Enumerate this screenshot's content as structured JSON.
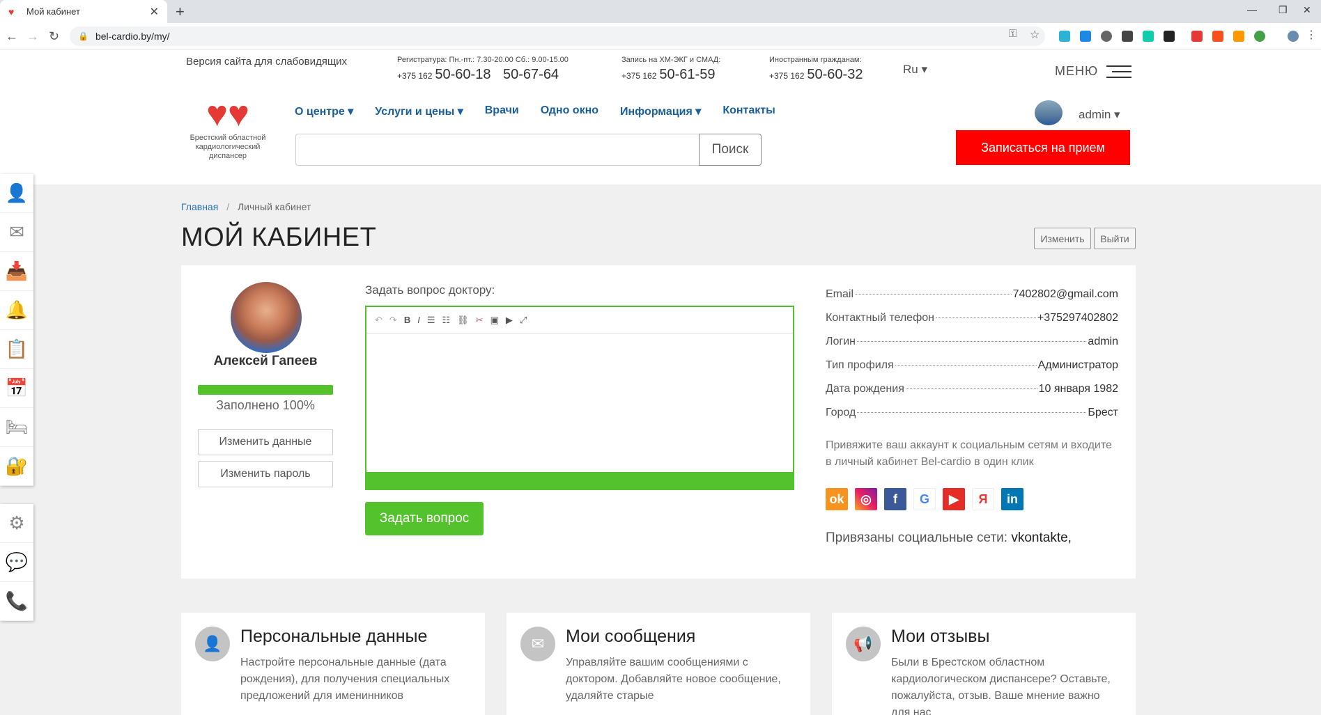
{
  "browser": {
    "tab_title": "Мой кабинет",
    "url": "bel-cardio.by/my/"
  },
  "header": {
    "low_vision": "Версия сайта для слабовидящих",
    "reg_label": "Регистратура: Пн.-пт.: 7.30-20.00 Сб.: 9.00-15.00",
    "reg_code": "+375 162",
    "reg_phone1": "50-60-18",
    "reg_phone2": "50-67-64",
    "ecg_label": "Запись на ХМ-ЭКГ и СМАД:",
    "ecg_code": "+375 162",
    "ecg_phone": "50-61-59",
    "foreign_label": "Иностранным гражданам:",
    "foreign_code": "+375 162",
    "foreign_phone": "50-60-32",
    "lang": "Ru",
    "menu_label": "МЕНЮ",
    "logo_text": "Брестский областной кардиологический диспансер",
    "nav": [
      "О центре",
      "Услуги и цены",
      "Врачи",
      "Одно окно",
      "Информация",
      "Контакты"
    ],
    "search_button": "Поиск",
    "user_name": "admin",
    "book_button": "Записаться на прием"
  },
  "breadcrumb": {
    "home": "Главная",
    "current": "Личный кабинет"
  },
  "page_title": "МОЙ КАБИНЕТ",
  "actions": {
    "edit": "Изменить",
    "logout": "Выйти"
  },
  "profile": {
    "name": "Алексей Гапеев",
    "progress_percent": 100,
    "progress_label": "Заполнено 100%",
    "change_data": "Изменить данные",
    "change_password": "Изменить пароль"
  },
  "question": {
    "label": "Задать вопрос доктору:",
    "submit": "Задать вопрос"
  },
  "info": [
    {
      "label": "Email",
      "value": "7402802@gmail.com"
    },
    {
      "label": "Контактный телефон",
      "value": "+375297402802"
    },
    {
      "label": "Логин",
      "value": "admin"
    },
    {
      "label": "Тип профиля",
      "value": "Администратор"
    },
    {
      "label": "Дата рождения",
      "value": "10 января 1982"
    },
    {
      "label": "Город",
      "value": "Брест"
    }
  ],
  "social_text": "Привяжите ваш аккаунт к социальным сетям и входите в личный кабинет Bel-cardio в один клик",
  "linked_label": "Привязаны социальные сети:",
  "linked_value": "vkontakte,",
  "features": [
    {
      "title": "Персональные данные",
      "desc": "Настройте персональные данные (дата рождения), для получения специальных предложений для именинников"
    },
    {
      "title": "Мои сообщения",
      "desc": "Управляйте вашим сообщениями с доктором. Добавляйте новое сообщение, удаляйте старые"
    },
    {
      "title": "Мои отзывы",
      "desc": "Были в Брестском областном кардиологическом диспансере? Оставьте, пожалуйста, отзыв. Ваше мнение важно для нас"
    }
  ],
  "colors": {
    "accent_green": "#54c22c",
    "book_red": "#ff0000",
    "nav_blue": "#1a5f9a"
  }
}
